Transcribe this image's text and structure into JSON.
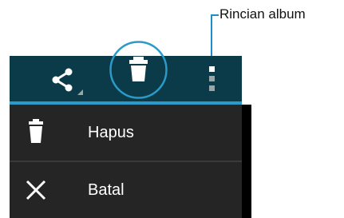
{
  "callout": {
    "label": "Rincian album"
  },
  "actionbar": {
    "icons": [
      "share-icon",
      "delete-icon",
      "overflow-menu-icon"
    ]
  },
  "menu": {
    "items": [
      {
        "icon": "trash-icon",
        "label": "Hapus"
      },
      {
        "icon": "close-icon",
        "label": "Batal"
      }
    ]
  },
  "colors": {
    "actionbar": "#0b3b49",
    "accent": "#2b9ac8",
    "menu_bg": "#252525",
    "callout_line": "#1a8fc7"
  }
}
